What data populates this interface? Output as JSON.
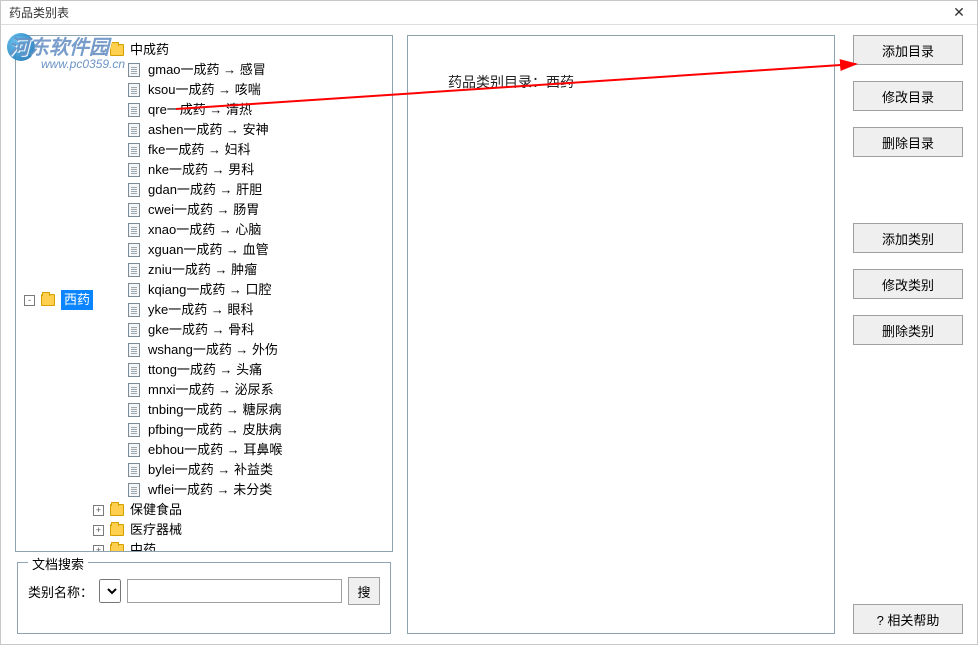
{
  "window": {
    "title": "药品类别表",
    "close": "✕"
  },
  "watermark": {
    "name": "河东软件园",
    "url": "www.pc0359.cn"
  },
  "tree": {
    "root_selected": "西药",
    "folders": [
      {
        "label": "中成药",
        "expanded": true
      },
      {
        "label": "保健食品",
        "expanded": false
      },
      {
        "label": "医疗器械",
        "expanded": false
      },
      {
        "label": "中药",
        "expanded": false
      }
    ],
    "zhongchengyao_items": [
      "gmao一成药 → 感冒",
      "ksou一成药 → 咳喘",
      "qre一成药 → 清热",
      "ashen一成药 → 安神",
      "fke一成药 → 妇科",
      "nke一成药 → 男科",
      "gdan一成药 → 肝胆",
      "cwei一成药 → 肠胃",
      "xnao一成药 → 心脑",
      "xguan一成药 → 血管",
      "zniu一成药 → 肿瘤",
      "kqiang一成药 → 口腔",
      "yke一成药 → 眼科",
      "gke一成药 → 骨科",
      "wshang一成药 → 外伤",
      "ttong一成药 → 头痛",
      "mnxi一成药 → 泌尿系",
      "tnbing一成药 → 糖尿病",
      "pfbing一成药 → 皮肤病",
      "ebhou一成药 → 耳鼻喉",
      "bylei一成药 → 补益类",
      "wflei一成药 → 未分类"
    ]
  },
  "search": {
    "legend": "文档搜索",
    "label": "类别名称：",
    "button": "搜"
  },
  "info": {
    "heading": "药品类别目录：西药"
  },
  "buttons": {
    "add_dir": "添加目录",
    "mod_dir": "修改目录",
    "del_dir": "删除目录",
    "add_cat": "添加类别",
    "mod_cat": "修改类别",
    "del_cat": "删除类别",
    "help": "? 相关帮助"
  }
}
